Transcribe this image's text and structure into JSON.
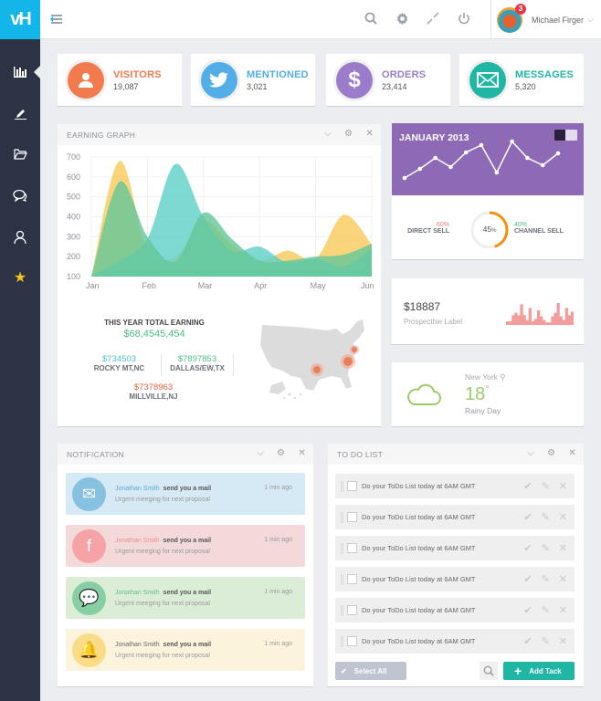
{
  "app": {
    "logo": "vH",
    "user_name": "Michael Firger",
    "notification_count": "3"
  },
  "topbar": {
    "icons": [
      "search-icon",
      "gear-icon",
      "compress-icon",
      "power-icon"
    ]
  },
  "sidebar": {
    "items": [
      {
        "icon": "bar-chart-icon",
        "active": true
      },
      {
        "icon": "pencil-icon"
      },
      {
        "icon": "folder-icon"
      },
      {
        "icon": "chat-icon"
      },
      {
        "icon": "user-icon"
      },
      {
        "icon": "star-icon"
      }
    ]
  },
  "stats": [
    {
      "label": "VISITORS",
      "value": "19,087",
      "color": "#f27a4f",
      "icon": "user-icon"
    },
    {
      "label": "MENTIONED",
      "value": "3,021",
      "color": "#53aee8",
      "icon": "twitter-icon"
    },
    {
      "label": "ORDERS",
      "value": "23,414",
      "color": "#9b7ccb",
      "icon": "dollar-icon"
    },
    {
      "label": "MESSAGES",
      "value": "5,320",
      "color": "#1fb7a3",
      "icon": "mail-icon"
    }
  ],
  "earning": {
    "title": "EARNING GRAPH",
    "total_label": "THIS YEAR TOTAL EARNING",
    "total_value": "$68,4545,454",
    "locations": [
      {
        "value": "$734503",
        "name": "ROCKY MT,NC",
        "color": "#4cc3c0"
      },
      {
        "value": "$7897853",
        "name": "DALLAS/EW,TX",
        "color": "#4fbf85"
      },
      {
        "value": "$7378963",
        "name": "MILLVILLE,NJ",
        "color": "#e8663d"
      }
    ]
  },
  "chart_data": {
    "type": "area",
    "title": "EARNING GRAPH",
    "categories": [
      "Jan",
      "Feb",
      "Mar",
      "Apr",
      "May",
      "Jun"
    ],
    "ylim": [
      100,
      700
    ],
    "yticks": [
      100,
      200,
      300,
      400,
      500,
      600,
      700
    ],
    "x": [
      0,
      0.5,
      1,
      1.5,
      2,
      2.5,
      3,
      3.5,
      4,
      4.5,
      5
    ],
    "series": [
      {
        "name": "yellow",
        "color": "#f7c95a",
        "values": [
          100,
          680,
          230,
          200,
          380,
          260,
          180,
          230,
          190,
          410,
          260
        ]
      },
      {
        "name": "teal",
        "color": "#5fd0c8",
        "values": [
          100,
          180,
          290,
          665,
          400,
          230,
          250,
          170,
          190,
          150,
          240
        ]
      },
      {
        "name": "green",
        "color": "#64c79a",
        "values": [
          100,
          575,
          300,
          175,
          420,
          290,
          180,
          180,
          200,
          210,
          265
        ]
      }
    ]
  },
  "january": {
    "title": "JANUARY 2013",
    "line": [
      10,
      20,
      32,
      22,
      38,
      46,
      16,
      50,
      32,
      24,
      37
    ],
    "direct_pct": "60%",
    "direct_label": "DIRECT SELL",
    "center_pct": "45",
    "center_unit": "%",
    "channel_pct": "40%",
    "channel_label": "CHANNEL SELL",
    "donut_fraction": 0.45
  },
  "prospect": {
    "value": "$18887",
    "label": "Prospecthie Label",
    "bars": [
      3,
      3,
      8,
      10,
      8,
      17,
      8,
      4,
      14,
      3,
      5,
      12,
      7,
      4,
      2,
      2,
      7,
      10,
      18,
      7,
      4,
      14,
      8,
      11
    ]
  },
  "weather": {
    "city": "New York",
    "temp": "18",
    "deg": "°",
    "desc": "Rainy Day"
  },
  "notifications": {
    "title": "NOTIFICATION",
    "items": [
      {
        "name": "Jonathan Smith",
        "action": "send you a mail",
        "message": "Urgent meeging for next proposal",
        "time": "1 min ago",
        "bg": "#d6eaf5",
        "ic": "#86c2e0",
        "nc": "#5aa9d6",
        "icon": "mail-icon",
        "glyph": "✉"
      },
      {
        "name": "Jonathan Smith",
        "action": "send you a mail",
        "message": "Urgent meeging for next proposal",
        "time": "1 min ago",
        "bg": "#f3d9da",
        "ic": "#f5a3a6",
        "nc": "#f08d91",
        "icon": "facebook-icon",
        "glyph": "f"
      },
      {
        "name": "Jonathan Smith",
        "action": "send you a mail",
        "message": "Urgent meeging for next proposal",
        "time": "1 min ago",
        "bg": "#dcedd7",
        "ic": "#87cfa3",
        "nc": "#62bf86",
        "icon": "chat-icon",
        "glyph": "💬"
      },
      {
        "name": "Jonathan Smith",
        "action": "send you a mail",
        "message": "Urgent meeging for next proposal",
        "time": "1 min ago",
        "bg": "#fbf3dc",
        "ic": "#fbdc86",
        "nc": "#666",
        "icon": "bell-icon",
        "glyph": "🔔"
      }
    ]
  },
  "todo": {
    "title": "TO DO LIST",
    "items": [
      "Do your ToDo List today at 6AM GMT",
      "Do your ToDo List today at 6AM GMT",
      "Do your ToDo List today at 6AM GMT",
      "Do your ToDo List today at 6AM GMT",
      "Do your ToDo List today at 6AM GMT",
      "Do your ToDo List today at 6AM GMT"
    ],
    "select_all": "Select All",
    "add_task": "Add Tack"
  }
}
